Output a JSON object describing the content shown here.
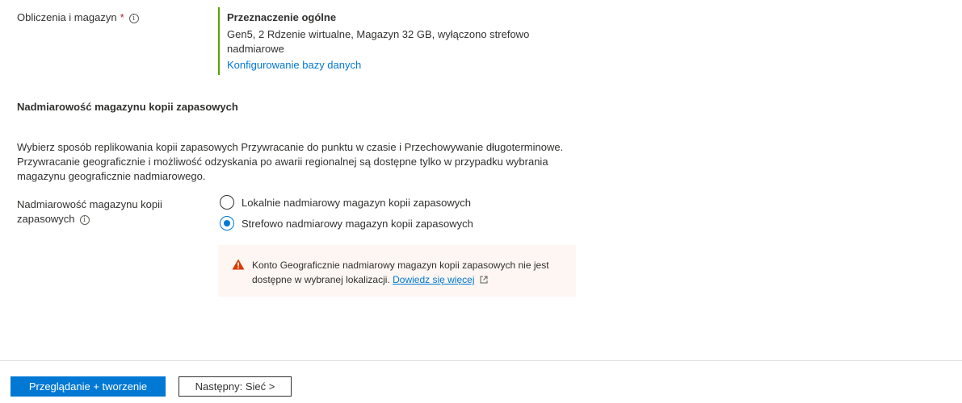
{
  "compute": {
    "label": "Obliczenia i magazyn",
    "required_mark": "*",
    "info_icon": "info-icon",
    "tier_title": "Przeznaczenie ogólne",
    "tier_description": "Gen5, 2 Rdzenie wirtualne, Magazyn 32 GB, wyłączono strefowo nadmiarowe",
    "configure_link": "Konfigurowanie bazy danych",
    "accent_color": "#57a300"
  },
  "backup_section": {
    "title": "Nadmiarowość magazynu kopii zapasowych",
    "description": "Wybierz sposób replikowania kopii zapasowych Przywracanie do punktu w czasie i Przechowywanie długoterminowe. Przywracanie geograficznie i możliwość odzyskania po awarii regionalnej są dostępne tylko w przypadku wybrania magazynu geograficznie nadmiarowego.",
    "field_label": "Nadmiarowość magazynu kopii zapasowych",
    "options": [
      {
        "label": "Lokalnie nadmiarowy magazyn kopii zapasowych",
        "selected": false
      },
      {
        "label": "Strefowo nadmiarowy magazyn kopii zapasowych",
        "selected": true
      }
    ],
    "warning": {
      "icon": "warning-icon",
      "text": "Konto Geograficznie nadmiarowy magazyn kopii zapasowych nie jest dostępne w wybranej lokalizacji.",
      "link": "Dowiedz się więcej",
      "link_icon": "external-link-icon",
      "background": "#fdf6f2",
      "icon_color": "#d83b01"
    }
  },
  "footer": {
    "primary_button": "Przeglądanie + tworzenie",
    "secondary_button": "Następny: Sieć >",
    "primary_color": "#0078d4"
  }
}
